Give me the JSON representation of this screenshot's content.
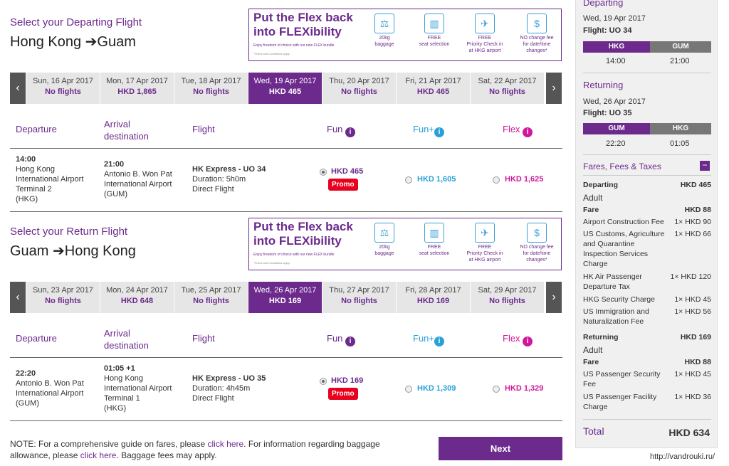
{
  "outbound": {
    "title": "Select your Departing Flight",
    "route_from": "Hong Kong",
    "route_arrow": "➔",
    "route_to": "Guam",
    "dates": [
      {
        "date": "Sun, 16 Apr 2017",
        "price": "No flights"
      },
      {
        "date": "Mon, 17 Apr 2017",
        "price": "HKD 1,865"
      },
      {
        "date": "Tue, 18 Apr 2017",
        "price": "No flights"
      },
      {
        "date": "Wed, 19 Apr 2017",
        "price": "HKD 465"
      },
      {
        "date": "Thu, 20 Apr 2017",
        "price": "No flights"
      },
      {
        "date": "Fri, 21 Apr 2017",
        "price": "HKD 465"
      },
      {
        "date": "Sat, 22 Apr 2017",
        "price": "No flights"
      }
    ],
    "headers": {
      "departure": "Departure",
      "arrival1": "Arrival",
      "arrival2": "destination",
      "flight": "Flight",
      "fun": "Fun",
      "funplus": "Fun+",
      "flex": "Flex"
    },
    "flight": {
      "dep_time": "14:00",
      "dep_place": [
        "Hong Kong",
        "International Airport",
        "Terminal 2",
        "(HKG)"
      ],
      "arr_time": "21:00",
      "arr_place": [
        "Antonio B. Won Pat",
        "International Airport",
        "(GUM)"
      ],
      "name": "HK Express - UO 34",
      "duration": "Duration: 5h0m",
      "type": "Direct Flight",
      "fun_price": "HKD 465",
      "promo": "Promo",
      "funplus_price": "HKD 1,605",
      "flex_price": "HKD 1,625"
    }
  },
  "return": {
    "title": "Select your Return Flight",
    "route_from": "Guam",
    "route_arrow": "➔",
    "route_to": "Hong Kong",
    "dates": [
      {
        "date": "Sun, 23 Apr 2017",
        "price": "No flights"
      },
      {
        "date": "Mon, 24 Apr 2017",
        "price": "HKD 648"
      },
      {
        "date": "Tue, 25 Apr 2017",
        "price": "No flights"
      },
      {
        "date": "Wed, 26 Apr 2017",
        "price": "HKD 169"
      },
      {
        "date": "Thu, 27 Apr 2017",
        "price": "No flights"
      },
      {
        "date": "Fri, 28 Apr 2017",
        "price": "HKD 169"
      },
      {
        "date": "Sat, 29 Apr 2017",
        "price": "No flights"
      }
    ],
    "headers": {
      "departure": "Departure",
      "arrival1": "Arrival",
      "arrival2": "destination",
      "flight": "Flight",
      "fun": "Fun",
      "funplus": "Fun+",
      "flex": "Flex"
    },
    "flight": {
      "dep_time": "22:20",
      "dep_place": [
        "Antonio B. Won Pat",
        "International Airport",
        "(GUM)"
      ],
      "arr_time": "01:05 +1",
      "arr_place": [
        "Hong Kong",
        "International Airport",
        "Terminal 1",
        "(HKG)"
      ],
      "name": "HK Express - UO 35",
      "duration": "Duration: 4h45m",
      "type": "Direct Flight",
      "fun_price": "HKD 169",
      "promo": "Promo",
      "funplus_price": "HKD 1,309",
      "flex_price": "HKD 1,329"
    }
  },
  "banner": {
    "line1": "Put the Flex back",
    "line2": "into FLEXibility",
    "sub": "Enjoy freedom of choice with our new FLEX bundle",
    "terms": "*Terms and Conditions apply",
    "items": [
      {
        "icon": "baggage-icon",
        "l1": "20kg",
        "l2": "baggage",
        "l3": ""
      },
      {
        "icon": "seat-icon",
        "l1": "FREE",
        "l2": "seat selection",
        "l3": ""
      },
      {
        "icon": "checkin-icon",
        "l1": "FREE",
        "l2": "Priority Check in",
        "l3": "at HKG airport"
      },
      {
        "icon": "change-icon",
        "l1": "NO change fee",
        "l2": "for date/time",
        "l3": "changes*"
      }
    ]
  },
  "note": {
    "t1": "NOTE: For a comprehensive guide on fares, please ",
    "link1": "click here",
    "t2": ". For information regarding baggage",
    "t3": "allowance, please ",
    "link2": "click here",
    "t4": ". Baggage fees may apply."
  },
  "next_label": "Next",
  "sidebar": {
    "departing_title": "Departing",
    "departing_date": "Wed, 19 Apr 2017",
    "departing_flight": "Flight: UO 34",
    "departing_from": "HKG",
    "departing_to": "GUM",
    "departing_dep_time": "14:00",
    "departing_arr_time": "21:00",
    "returning_title": "Returning",
    "returning_date": "Wed, 26 Apr 2017",
    "returning_flight": "Flight: UO 35",
    "returning_from": "GUM",
    "returning_to": "HKG",
    "returning_dep_time": "22:20",
    "returning_arr_time": "01:05",
    "fares_title": "Fares, Fees & Taxes",
    "dep_label": "Departing",
    "dep_total": "HKD 465",
    "dep_adult": "Adult",
    "dep_fare_label": "Fare",
    "dep_fare": "HKD 88",
    "dep_fees": [
      {
        "label": "Airport Construction Fee",
        "value": "1× HKD 90"
      },
      {
        "label": "US Customs, Agriculture and Quarantine Inspection Services Charge",
        "value": "1× HKD 66"
      },
      {
        "label": "HK Air Passenger Departure Tax",
        "value": "1× HKD 120"
      },
      {
        "label": "HKG Security Charge",
        "value": "1× HKD 45"
      },
      {
        "label": "US Immigration and Naturalization Fee",
        "value": "1× HKD 56"
      }
    ],
    "ret_label": "Returning",
    "ret_total": "HKD 169",
    "ret_adult": "Adult",
    "ret_fare_label": "Fare",
    "ret_fare": "HKD 88",
    "ret_fees": [
      {
        "label": "US Passenger Security Fee",
        "value": "1× HKD 45"
      },
      {
        "label": "US Passenger Facility Charge",
        "value": "1× HKD 36"
      }
    ],
    "total_label": "Total",
    "total_value": "HKD 634"
  },
  "watermark": "http://vandrouki.ru/",
  "colors": {
    "brand": "#6b2a8c",
    "funplus": "#2aa0d8",
    "flex": "#d0189a",
    "promo": "#e8001c"
  }
}
